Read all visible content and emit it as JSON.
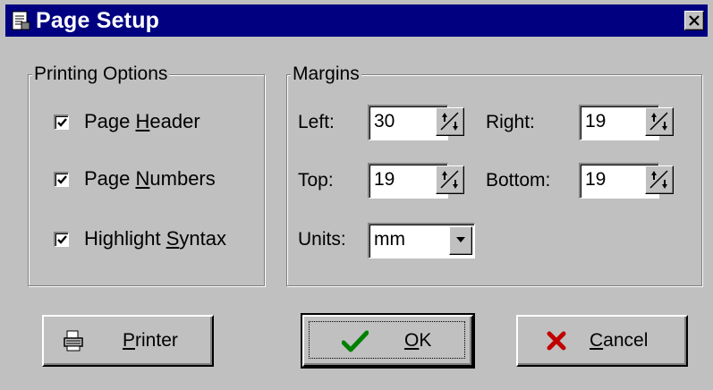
{
  "window": {
    "title": "Page Setup",
    "title_icon": "page-setup-icon",
    "close_icon": "close-icon"
  },
  "printing_options": {
    "title": "Printing Options",
    "items": [
      {
        "pre": "Page ",
        "accel": "H",
        "post": "eader",
        "checked": true
      },
      {
        "pre": "Page ",
        "accel": "N",
        "post": "umbers",
        "checked": true
      },
      {
        "pre": "Highlight ",
        "accel": "S",
        "post": "yntax",
        "checked": true
      }
    ]
  },
  "margins": {
    "title": "Margins",
    "left_label": "Left:",
    "left_value": "30",
    "right_label": "Right:",
    "right_value": "19",
    "top_label": "Top:",
    "top_value": "19",
    "bottom_label": "Bottom:",
    "bottom_value": "19",
    "units_label": "Units:",
    "units_value": "mm"
  },
  "buttons": {
    "printer": {
      "accel": "P",
      "rest": "rinter",
      "icon": "printer-icon"
    },
    "ok": {
      "accel": "O",
      "rest": "K",
      "icon": "checkmark-icon"
    },
    "cancel": {
      "accel": "C",
      "rest": "ancel",
      "icon": "x-icon"
    }
  },
  "colors": {
    "titlebar": "#000080",
    "face": "#c0c0c0",
    "ok_check": "#008000",
    "cancel_x": "#c00000"
  }
}
